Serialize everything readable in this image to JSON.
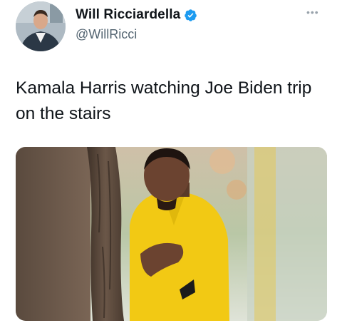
{
  "author": {
    "name": "Will Ricciardella",
    "handle": "@WillRicci",
    "verified": true,
    "avatar_icon": "profile-photo",
    "verified_icon": "verified-badge-icon"
  },
  "more_icon": "more-options-icon",
  "tweet": {
    "text": "Kamala Harris watching Joe Biden trip on the stairs"
  },
  "media": {
    "type": "photo",
    "subject": "man in yellow suit peeking from behind tree"
  },
  "colors": {
    "verified_blue": "#1d9bf0",
    "handle_gray": "#536471",
    "text": "#0f1419"
  }
}
